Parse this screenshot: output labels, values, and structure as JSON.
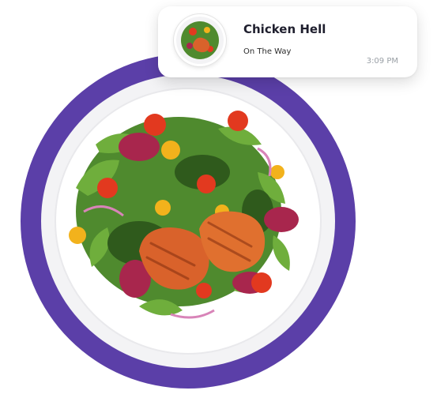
{
  "notification": {
    "title": "Chicken Hell",
    "status": "On The Way",
    "time": "3:09 PM",
    "thumbnail_icon": "salad-bowl-thumbnail"
  },
  "hero": {
    "image": "salmon-salad-plate",
    "colors": {
      "plate_rim": "#5b3fa8",
      "plate": "#f4f4f6",
      "salmon": "#d9622b",
      "greens": "#4f8a2e",
      "tomato": "#e2391f"
    }
  }
}
